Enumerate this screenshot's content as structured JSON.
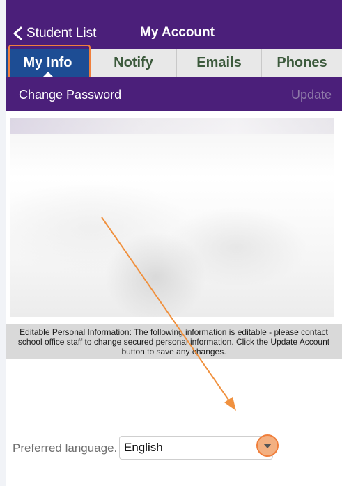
{
  "header": {
    "back_label": "Student List",
    "title": "My Account"
  },
  "tabs": [
    {
      "label": "My Info",
      "active": true
    },
    {
      "label": "Notify",
      "active": false
    },
    {
      "label": "Emails",
      "active": false
    },
    {
      "label": "Phones",
      "active": false
    }
  ],
  "subbar": {
    "change_password_label": "Change Password",
    "update_label": "Update"
  },
  "notice": {
    "text": "Editable Personal Information:  The following information is editable - please contact school office staff to change secured personal information. Click the Update Account button to save any changes."
  },
  "preferred_language": {
    "label": "Preferred language.",
    "selected_value": "English"
  },
  "colors": {
    "header_bg": "#4b1f7a",
    "active_tab_bg": "#1d4d94",
    "inactive_tab_bg": "#e8e8e8",
    "highlight_orange": "#f07f3c"
  },
  "icons": {
    "back": "chevron-left-icon",
    "dropdown": "chevron-down-icon"
  }
}
